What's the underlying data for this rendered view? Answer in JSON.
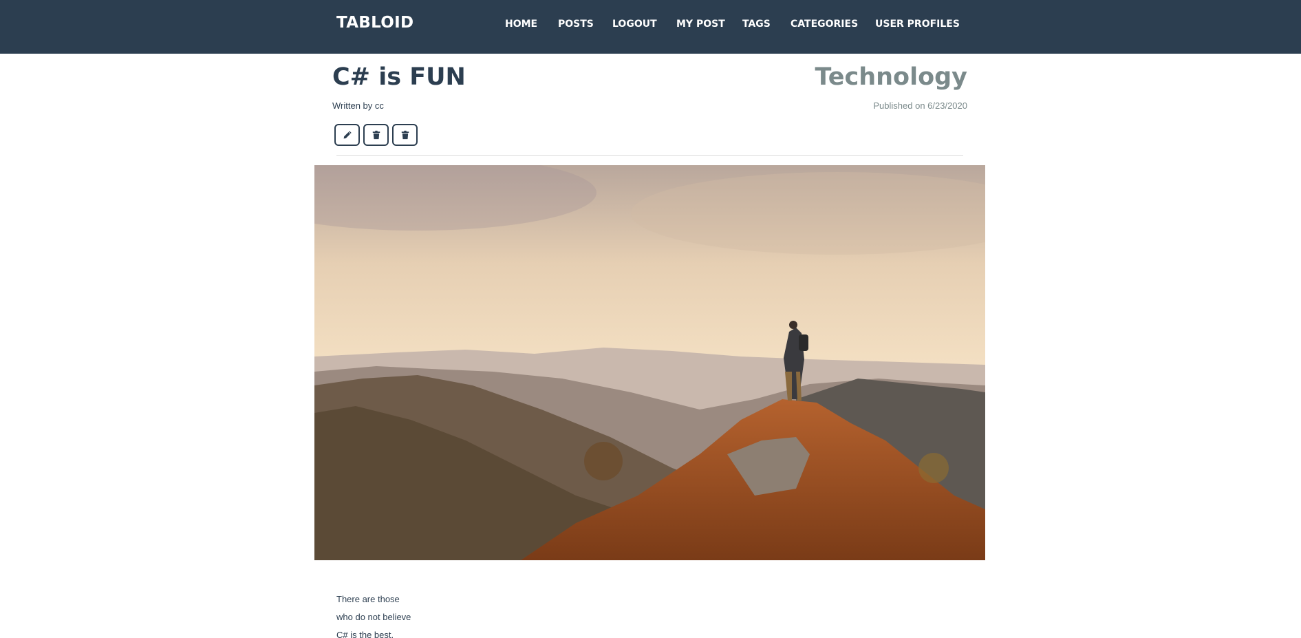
{
  "navbar": {
    "brand": "TABLOID",
    "items": [
      "HOME",
      "POSTS",
      "LOGOUT",
      "MY POST",
      "TAGS",
      "CATEGORIES",
      "USER PROFILES"
    ]
  },
  "post": {
    "title": "C# is FUN",
    "category": "Technology",
    "author_line": "Written by cc",
    "published_line": "Published on 6/23/2020",
    "content_lines": [
      "There are those",
      "who do not believe",
      "C# is the best."
    ]
  },
  "actions": {
    "icons": [
      "pencil-icon",
      "trash-icon",
      "trash-icon"
    ]
  },
  "colors": {
    "navbar": "#2c3e50",
    "title": "#2c3e50",
    "category": "#7b8a8b",
    "button_border": "#2c3e50"
  }
}
